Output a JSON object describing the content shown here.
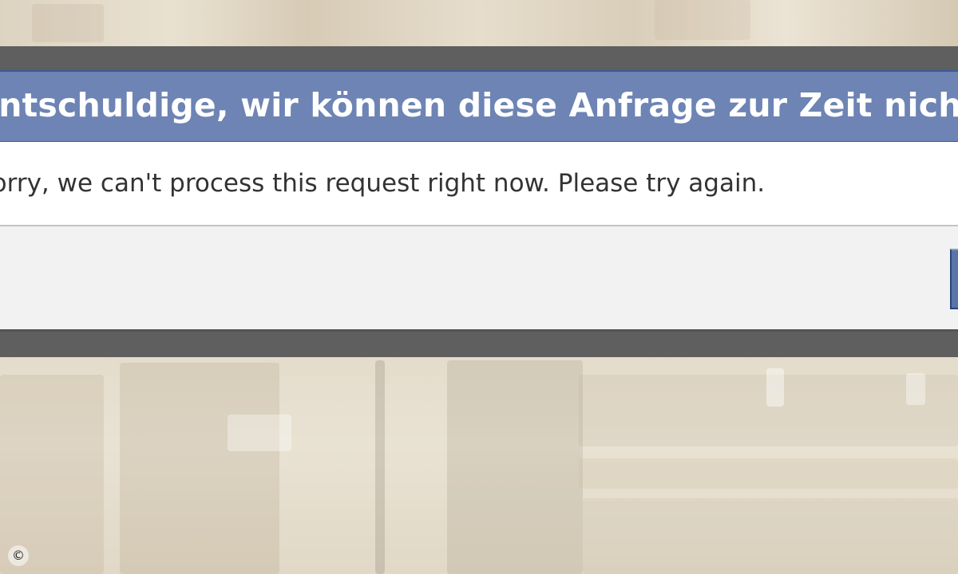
{
  "dialog": {
    "title": "Entschuldige, wir können diese Anfrage zur Zeit nicht bearbeiten.",
    "message": "Sorry, we can't process this request right now. Please try again.",
    "footer_button_label": ""
  },
  "copyright_symbol": "©",
  "colors": {
    "header_bg": "#6d84b4",
    "header_border": "#3b5998",
    "body_bg": "#ffffff",
    "footer_bg": "#f2f2f2",
    "frame": "#5f5f5f",
    "button_bg": "#5b74a8"
  }
}
